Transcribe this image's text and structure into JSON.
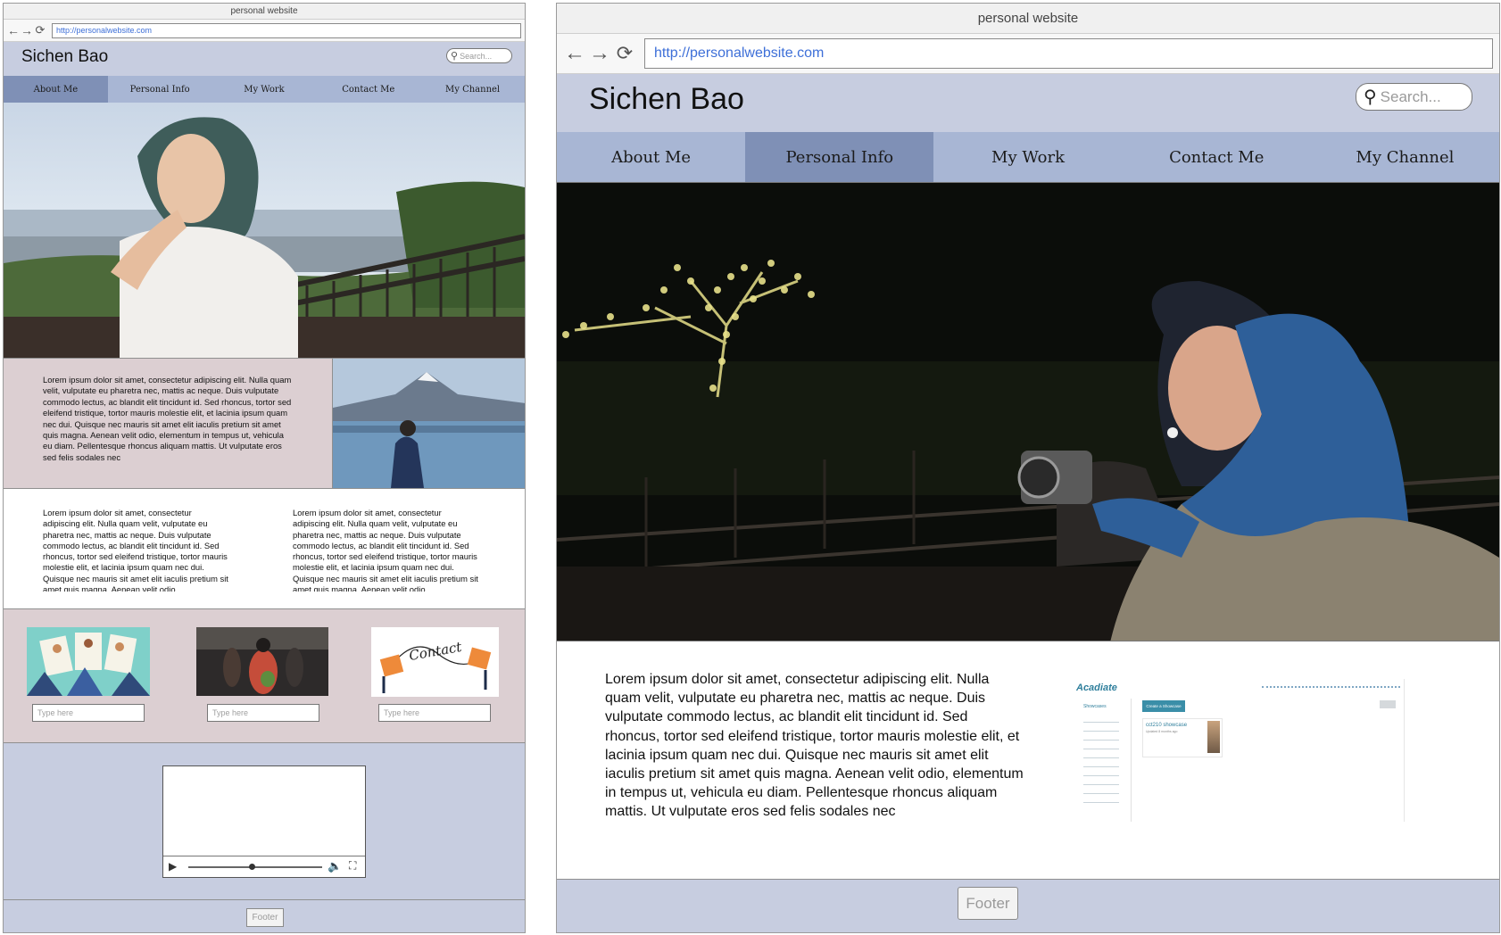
{
  "browser": {
    "title": "personal website",
    "url": "http://personalwebsite.com"
  },
  "site": {
    "name": "Sichen Bao",
    "search_placeholder": "Search..."
  },
  "nav": {
    "items": [
      "About Me",
      "Personal Info",
      "My Work",
      "Contact Me",
      "My Channel"
    ]
  },
  "left_page": {
    "active_nav": "About Me",
    "intro_text": "Lorem ipsum dolor sit amet, consectetur adipiscing elit. Nulla quam velit, vulputate eu pharetra nec, mattis ac neque. Duis vulputate commodo lectus, ac blandit elit tincidunt id. Sed rhoncus, tortor sed eleifend tristique, tortor mauris molestie elit, et lacinia ipsum quam nec dui. Quisque nec mauris sit amet elit iaculis pretium sit amet quis magna. Aenean velit odio, elementum in tempus ut, vehicula eu diam. Pellentesque rhoncus aliquam mattis. Ut vulputate eros sed felis sodales nec",
    "col_text_1": "Lorem ipsum dolor sit amet, consectetur adipiscing elit. Nulla quam velit, vulputate eu pharetra nec, mattis ac neque. Duis vulputate commodo lectus, ac blandit elit tincidunt id. Sed rhoncus, tortor sed eleifend tristique, tortor mauris molestie elit, et lacinia ipsum quam nec dui. Quisque nec mauris sit amet elit iaculis pretium sit amet quis magna. Aenean velit odio,",
    "col_text_2": "Lorem ipsum dolor sit amet, consectetur adipiscing elit. Nulla quam velit, vulputate eu pharetra nec, mattis ac neque. Duis vulputate commodo lectus, ac blandit elit tincidunt id. Sed rhoncus, tortor sed eleifend tristique, tortor mauris molestie elit, et lacinia ipsum quam nec dui. Quisque nec mauris sit amet elit iaculis pretium sit amet quis magna. Aenean velit odio,",
    "card_placeholder": "Type here",
    "contact_image_text": "Contact",
    "footer": "Footer"
  },
  "right_page": {
    "active_nav": "Personal Info",
    "body_text": "Lorem ipsum dolor sit amet, consectetur adipiscing elit. Nulla quam velit, vulputate eu pharetra nec, mattis ac neque. Duis vulputate commodo lectus, ac blandit elit tincidunt id. Sed rhoncus, tortor sed eleifend tristique, tortor mauris molestie elit, et lacinia ipsum quam nec dui. Quisque nec mauris sit amet elit iaculis pretium sit amet quis magna. Aenean velit odio, elementum in tempus ut, vehicula eu diam. Pellentesque rhoncus aliquam mattis. Ut vulputate eros sed felis sodales nec",
    "footer": "Footer",
    "screenshot": {
      "logo": "Acadiate",
      "button": "Create a Showcase",
      "card_title": "cct210 showcase",
      "card_sub": "Updated 8 months ago",
      "sidebar_heading": "Showcases"
    }
  },
  "icons": [
    "back-arrow-icon",
    "forward-arrow-icon",
    "reload-icon",
    "search-icon",
    "play-icon",
    "volume-icon",
    "fullscreen-icon"
  ],
  "colors": {
    "header": "#c7cde0",
    "nav": "#a8b6d4",
    "nav_active": "#7f90b6",
    "pink_panel": "#dccfd2",
    "url": "#3d6fd8"
  }
}
